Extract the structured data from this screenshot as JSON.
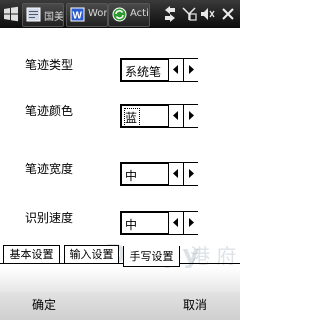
{
  "taskbar": {
    "tasks": [
      {
        "label": "国美",
        "icon": "document-icon"
      },
      {
        "label": "Wor",
        "icon": "word-icon"
      },
      {
        "label": "Acti",
        "icon": "activesync-icon"
      }
    ],
    "tray_icons": [
      "connectivity-icon",
      "signal-off-icon",
      "volume-icon",
      "close-icon"
    ]
  },
  "form": {
    "rows": [
      {
        "label": "笔迹类型",
        "value": "系统笔"
      },
      {
        "label": "笔迹颜色",
        "value": "蓝"
      },
      {
        "label": "笔迹宽度",
        "value": "中"
      },
      {
        "label": "识别速度",
        "value": "中"
      }
    ]
  },
  "tabs": [
    {
      "label": "基本设置"
    },
    {
      "label": "输入设置"
    },
    {
      "label": "手写设置",
      "active": true
    }
  ],
  "softkeys": {
    "left": "确定",
    "right": "取消"
  },
  "watermark": {
    "text": "Dospy",
    "suffix": "港 府"
  }
}
